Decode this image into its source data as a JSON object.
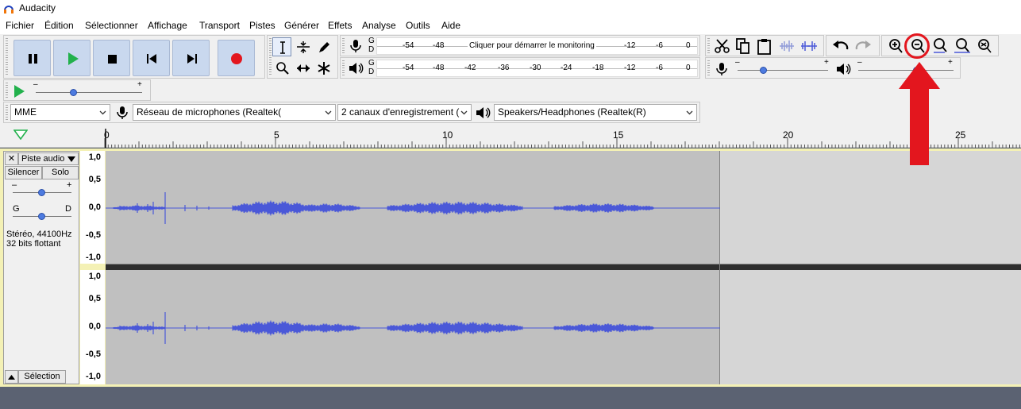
{
  "window": {
    "title": "Audacity"
  },
  "menu": [
    "Fichier",
    "Édition",
    "Sélectionner",
    "Affichage",
    "Transport",
    "Pistes",
    "Générer",
    "Effets",
    "Analyse",
    "Outils",
    "Aide"
  ],
  "meters": {
    "record_channels": [
      "G",
      "D"
    ],
    "play_channels": [
      "G",
      "D"
    ],
    "record_ticks": [
      "-54",
      "-48",
      "-12",
      "-6",
      "0"
    ],
    "record_prompt": "Cliquer pour démarrer le monitoring",
    "play_ticks": [
      "-54",
      "-48",
      "-42",
      "-36",
      "-30",
      "-24",
      "-18",
      "-12",
      "-6",
      "0"
    ]
  },
  "sliders": {
    "minus": "–",
    "plus": "+",
    "playback_speed_level": 0.36,
    "mic_volume_level": 0.29,
    "speaker_volume_level": 0.62
  },
  "device": {
    "host": "MME",
    "recording_device": "Réseau de microphones (Realtek(",
    "channels": "2 canaux d'enregistrement (",
    "playback_device": "Speakers/Headphones (Realtek(R)"
  },
  "ruler": {
    "labels": [
      "0",
      "5",
      "10",
      "15",
      "20",
      "25"
    ]
  },
  "track": {
    "name": "Piste audio",
    "mute": "Silencer",
    "solo": "Solo",
    "gain_minus": "–",
    "gain_plus": "+",
    "pan_left": "G",
    "pan_right": "D",
    "gain_level": 0.5,
    "pan_level": 0.5,
    "format_rate": "Stéréo, 44100Hz",
    "format_bits": "32 bits flottant",
    "select": "Sélection",
    "scale": [
      "1,0",
      "0,5",
      "0,0",
      "-0,5",
      "-1,0"
    ]
  },
  "colors": {
    "accent": "#4a58d8",
    "highlight": "#e3161e",
    "record": "#e3161e"
  }
}
